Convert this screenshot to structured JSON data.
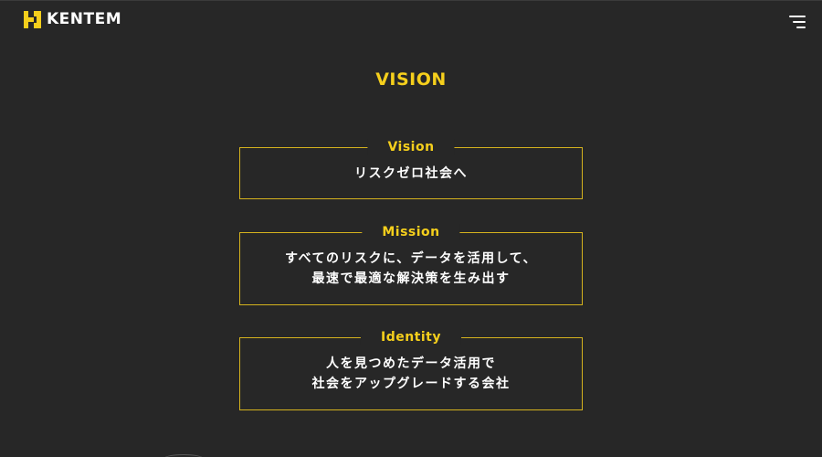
{
  "header": {
    "logo_text": "KENTEM",
    "logo_icon": "kentem-k-mark-icon",
    "menu_icon": "hamburger-menu-icon",
    "brand_color": "#f5cf1c"
  },
  "section": {
    "title": "VISION"
  },
  "cards": {
    "vision": {
      "label": "Vision",
      "line1": "リスクゼロ社会へ"
    },
    "mission": {
      "label": "Mission",
      "line1": "すべてのリスクに、データを活用して、",
      "line2": "最速で最適な解決策を生み出す"
    },
    "identity": {
      "label": "Identity",
      "line1": "人を見つめたデータ活用で",
      "line2": "社会をアップグレードする会社"
    }
  },
  "colors": {
    "background": "#272727",
    "accent": "#f5cf1c",
    "border": "#d4b21e",
    "text": "#ffffff"
  }
}
